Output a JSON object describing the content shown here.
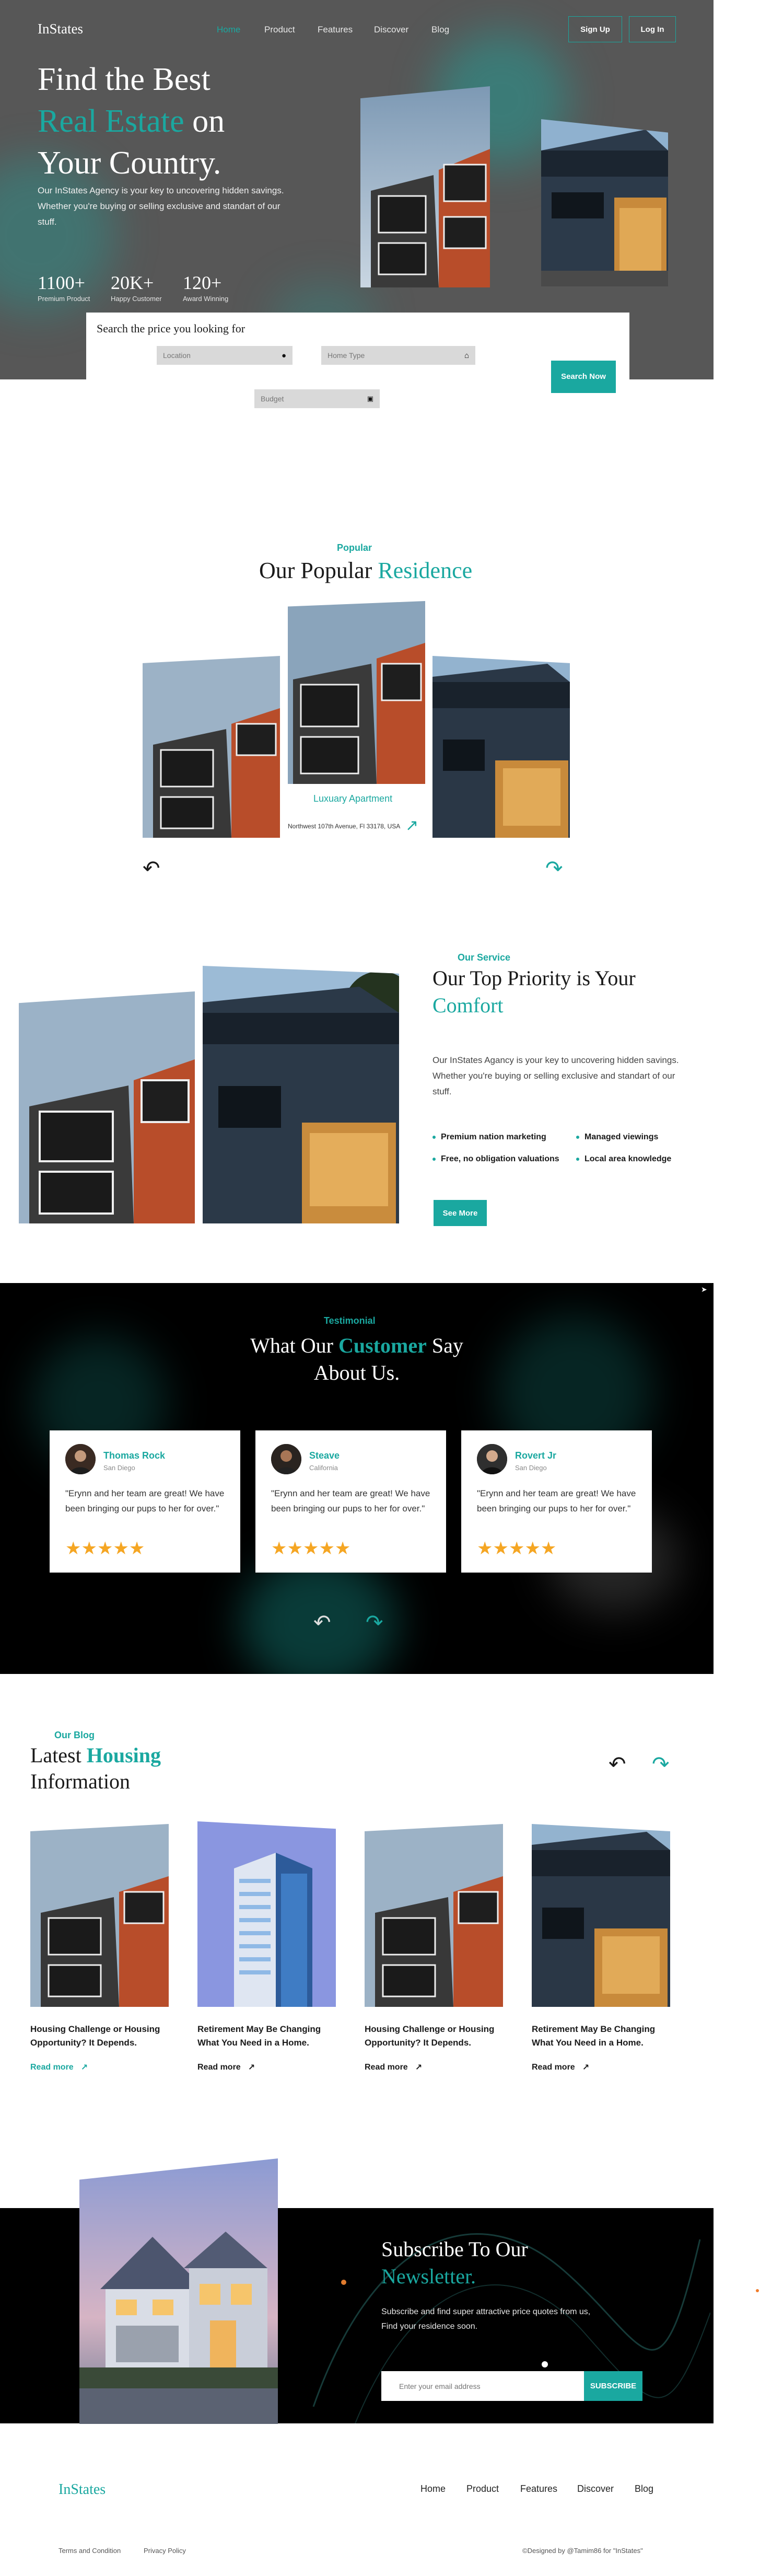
{
  "brand": {
    "logo": "InStates",
    "accent": "#1aa8a0"
  },
  "nav": {
    "links": [
      "Home",
      "Product",
      "Features",
      "Discover",
      "Blog"
    ],
    "signup": "Sign Up",
    "login": "Log In"
  },
  "hero": {
    "title_line1": "Find the Best",
    "title_accent": "Real Estate",
    "title_on": "on",
    "title_line3": "Your Country.",
    "description": "Our InStates Agency is your key to uncovering hidden savings. Whether you're buying or selling exclusive and standart of our stuff.",
    "stats": [
      {
        "value": "1100+",
        "label": "Premium Product"
      },
      {
        "value": "20K+",
        "label": "Happy Customer"
      },
      {
        "value": "120+",
        "label": "Award Winning"
      }
    ]
  },
  "search": {
    "title": "Search the price you looking for",
    "location": "Location",
    "home_type": "Home Type",
    "budget": "Budget",
    "button": "Search Now"
  },
  "popular": {
    "eyebrow": "Popular",
    "title": "Our Popular",
    "title_accent": "Residence",
    "featured_name": "Luxuary Apartment",
    "featured_address": "Northwest 107th Avenue, Fl 33178, USA"
  },
  "service": {
    "eyebrow": "Our Service",
    "title": "Our Top Priority is Your",
    "title_accent": "Comfort",
    "description": "Our InStates Agancy is your key to uncovering hidden savings. Whether you're buying or selling exclusive and standart of our stuff.",
    "features": [
      "Premium nation marketing",
      "Managed viewings",
      "Free, no obligation valuations",
      "Local area knowledge"
    ],
    "button": "See More"
  },
  "testimonial": {
    "eyebrow": "Testimonial",
    "title": "What Our",
    "title_accent": "Customer",
    "title_say": "Say",
    "title_line2": "About Us.",
    "cards": [
      {
        "name": "Thomas Rock",
        "location": "San Diego",
        "quote": "\"Erynn and her team are great! We have been bringing our pups to her for over.\"",
        "stars": "★★★★★"
      },
      {
        "name": "Steave",
        "location": "California",
        "quote": "\"Erynn and her team are great! We have been bringing our pups to her for over.\"",
        "stars": "★★★★★"
      },
      {
        "name": "Rovert Jr",
        "location": "San Diego",
        "quote": "\"Erynn and her team are great! We have been bringing our pups to her for over.\"",
        "stars": "★★★★★"
      }
    ]
  },
  "blog": {
    "eyebrow": "Our Blog",
    "title": "Latest",
    "title_accent": "Housing",
    "title_line2": "Information",
    "posts": [
      {
        "title": "Housing Challenge or Housing Opportunity? It Depends.",
        "read_more": "Read more"
      },
      {
        "title": "Retirement May Be Changing What You Need in a Home.",
        "read_more": "Read more"
      },
      {
        "title": "Housing Challenge or Housing Opportunity? It Depends.",
        "read_more": "Read more"
      },
      {
        "title": "Retirement May Be Changing What You Need in a Home.",
        "read_more": "Read more"
      }
    ]
  },
  "newsletter": {
    "title": "Subscribe To Our",
    "title_accent": "Newsletter.",
    "description": "Subscribe and find super attractive price quotes from us, Find your residence soon.",
    "placeholder": "Enter your email address",
    "button": "SUBSCRIBE"
  },
  "footer": {
    "logo": "InStates",
    "links": [
      "Home",
      "Product",
      "Features",
      "Discover",
      "Blog"
    ],
    "terms": "Terms and Condition",
    "privacy": "Privacy Policy",
    "credit": "©Designed by @Tamim86 for \"InStates\""
  }
}
